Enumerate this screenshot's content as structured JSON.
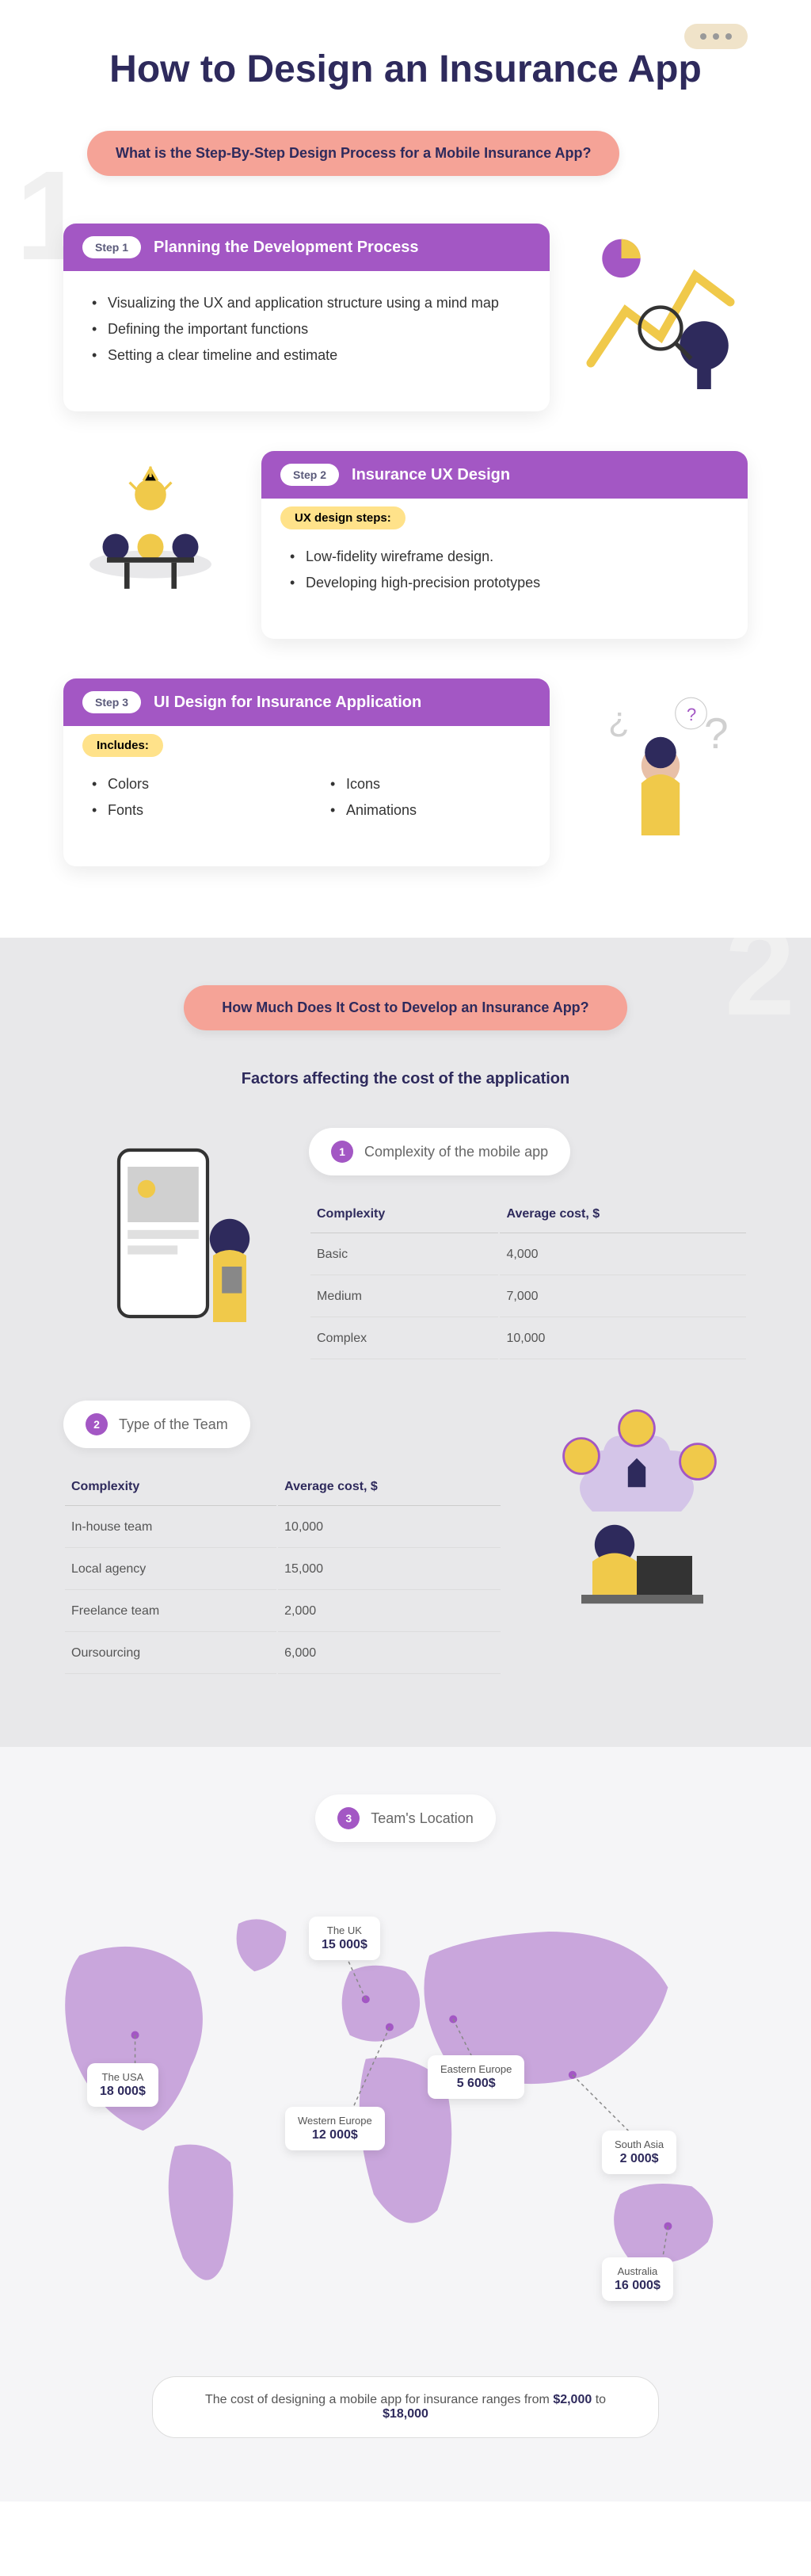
{
  "title": "How to Design an Insurance App",
  "q1": "What is the Step-By-Step Design Process for a Mobile Insurance App?",
  "q2": "How Much Does It Cost to Develop an Insurance App?",
  "step1": {
    "badge": "Step 1",
    "title": "Planning the Development Process",
    "bullets": [
      "Visualizing the UX and application structure using a mind map",
      "Defining the important functions",
      "Setting a clear timeline and estimate"
    ]
  },
  "step2": {
    "badge": "Step 2",
    "title": "Insurance UX Design",
    "sub": "UX design steps:",
    "bullets": [
      "Low-fidelity wireframe design.",
      "Developing high-precision prototypes"
    ]
  },
  "step3": {
    "badge": "Step 3",
    "title": "UI Design for Insurance Application",
    "sub": "Includes:",
    "col1": [
      "Colors",
      "Fonts"
    ],
    "col2": [
      "Icons",
      "Animations"
    ]
  },
  "factors_heading": "Factors affecting the cost of the application",
  "factor1": {
    "num": "1",
    "label": "Complexity of the mobile app",
    "headers": [
      "Complexity",
      "Average cost, $"
    ],
    "rows": [
      [
        "Basic",
        "4,000"
      ],
      [
        "Medium",
        "7,000"
      ],
      [
        "Complex",
        "10,000"
      ]
    ]
  },
  "factor2": {
    "num": "2",
    "label": "Type of the Team",
    "headers": [
      "Complexity",
      "Average cost, $"
    ],
    "rows": [
      [
        "In-house team",
        "10,000"
      ],
      [
        "Local agency",
        "15,000"
      ],
      [
        "Freelance team",
        "2,000"
      ],
      [
        "Oursourcing",
        "6,000"
      ]
    ]
  },
  "factor3": {
    "num": "3",
    "label": "Team's Location"
  },
  "map": {
    "uk": {
      "region": "The UK",
      "price": "15 000$"
    },
    "usa": {
      "region": "The USA",
      "price": "18 000$"
    },
    "we": {
      "region": "Western Europe",
      "price": "12 000$"
    },
    "ee": {
      "region": "Eastern Europe",
      "price": "5 600$"
    },
    "sa": {
      "region": "South Asia",
      "price": "2 000$"
    },
    "au": {
      "region": "Australia",
      "price": "16 000$"
    }
  },
  "summary": {
    "prefix": "The cost of designing a mobile app for insurance ranges from",
    "min": "$2,000",
    "to": "to",
    "max": "$18,000"
  },
  "chart_data": [
    {
      "type": "table",
      "title": "Complexity of the mobile app",
      "categories": [
        "Basic",
        "Medium",
        "Complex"
      ],
      "values": [
        4000,
        7000,
        10000
      ],
      "xlabel": "Complexity",
      "ylabel": "Average cost, $"
    },
    {
      "type": "table",
      "title": "Type of the Team",
      "categories": [
        "In-house team",
        "Local agency",
        "Freelance team",
        "Oursourcing"
      ],
      "values": [
        10000,
        15000,
        2000,
        6000
      ],
      "xlabel": "Complexity",
      "ylabel": "Average cost, $"
    },
    {
      "type": "table",
      "title": "Team's Location",
      "categories": [
        "The UK",
        "The USA",
        "Western Europe",
        "Eastern Europe",
        "South Asia",
        "Australia"
      ],
      "values": [
        15000,
        18000,
        12000,
        5600,
        2000,
        16000
      ],
      "ylabel": "Cost, $"
    }
  ]
}
